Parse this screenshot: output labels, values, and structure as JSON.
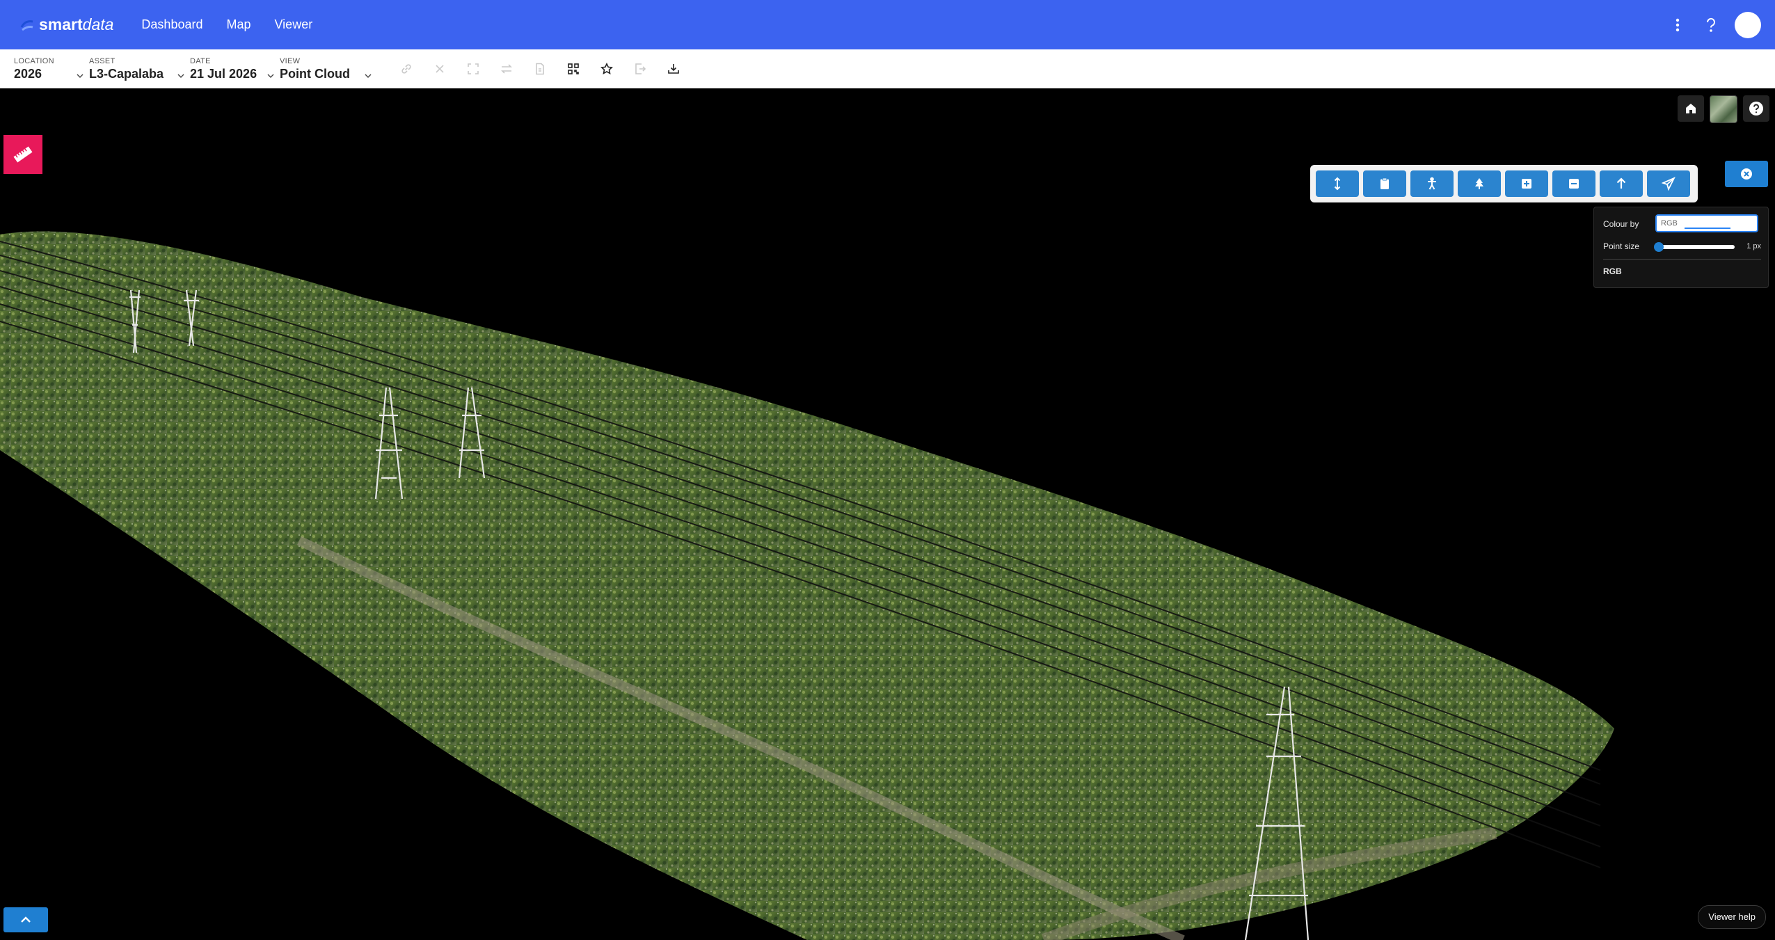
{
  "app": {
    "logo_bold": "smart",
    "logo_italic": "data",
    "nav": [
      "Dashboard",
      "Map",
      "Viewer"
    ]
  },
  "selectors": {
    "location": {
      "label": "LOCATION",
      "value": "2026"
    },
    "asset": {
      "label": "ASSET",
      "value": "L3-Capalaba"
    },
    "date": {
      "label": "DATE",
      "value": "21 Jul 2026"
    },
    "view": {
      "label": "VIEW",
      "value": "Point Cloud"
    }
  },
  "toolbar_icons": [
    "link-icon",
    "close-icon",
    "expand-icon",
    "swap-icon",
    "document-icon",
    "qr-code-icon",
    "star-icon",
    "export-icon",
    "download-icon"
  ],
  "viewer_tools": [
    "height-icon",
    "clipboard-icon",
    "person-icon",
    "tree-icon",
    "add-box-icon",
    "remove-box-icon",
    "arrow-up-icon",
    "send-icon"
  ],
  "panel": {
    "colour_by_label": "Colour by",
    "colour_by_value": "RGB",
    "point_size_label": "Point size",
    "point_size_value": "1 px",
    "point_size_level": 0.0,
    "legend": "RGB"
  },
  "viewer_help": "Viewer help",
  "colors": {
    "appbar": "#3c63f0",
    "accent": "#1f7fd1",
    "measure": "#e8195a"
  }
}
